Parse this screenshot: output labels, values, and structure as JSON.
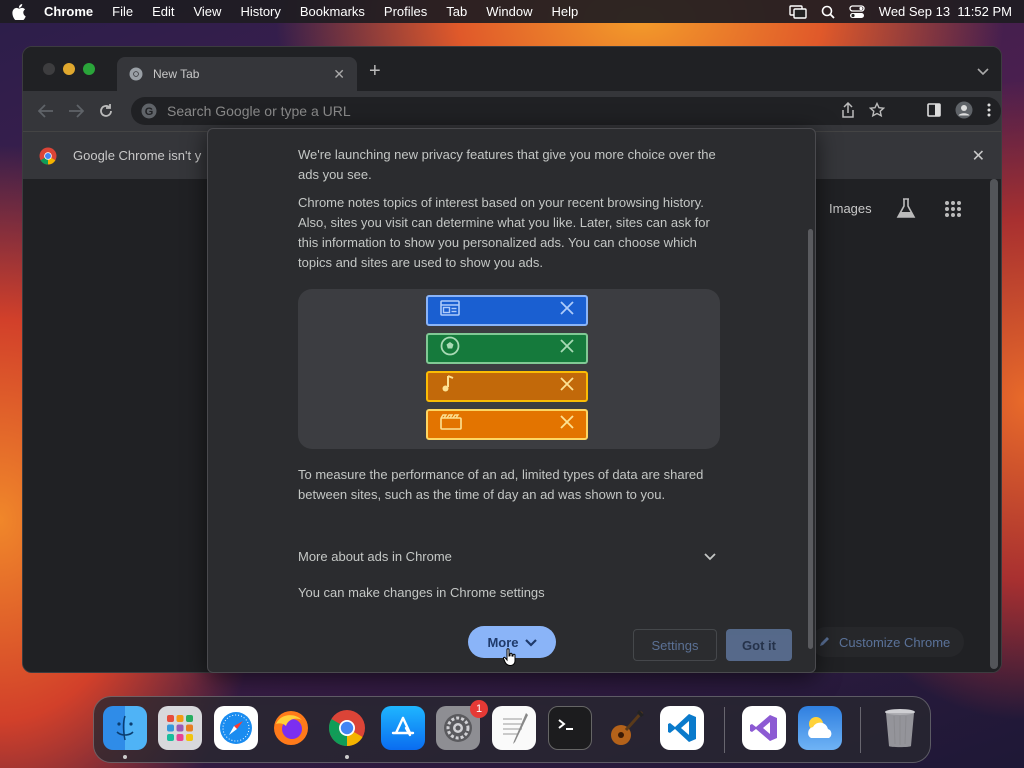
{
  "menubar": {
    "app_name": "Chrome",
    "menus": [
      "File",
      "Edit",
      "View",
      "History",
      "Bookmarks",
      "Profiles",
      "Tab",
      "Window",
      "Help"
    ],
    "clock": "Wed Sep 13  11:52 PM"
  },
  "browser": {
    "tab_title": "New Tab",
    "omnibox_placeholder": "Search Google or type a URL",
    "infobar_text": "Google Chrome isn't y",
    "images_link": "Images",
    "customize_button": "Customize Chrome"
  },
  "dialog": {
    "intro": "We're launching new privacy features that give you more choice over the ads you see.",
    "topics": "Chrome notes topics of interest based on your recent browsing history. Also, sites you visit can determine what you like. Later, sites can ask for this information to show you personalized ads. You can choose which topics and sites are used to show you ads.",
    "illustration_rows": [
      {
        "icon": "browser-window-icon",
        "color": "#1a5fd1",
        "border": "#8ab4f8",
        "fg": "#aecbfa"
      },
      {
        "icon": "soccer-ball-icon",
        "color": "#157a3c",
        "border": "#81c995",
        "fg": "#a8dab5"
      },
      {
        "icon": "music-note-icon",
        "color": "#c2690a",
        "border": "#fbbc04",
        "fg": "#fde293"
      },
      {
        "icon": "clapperboard-icon",
        "color": "#e37400",
        "border": "#fdd663",
        "fg": "#fde293"
      }
    ],
    "measure": "To measure the performance of an ad, limited types of data are shared between sites, such as the time of day an ad was shown to you.",
    "more_about": "More about ads in Chrome",
    "settings_note": "You can make changes in Chrome settings",
    "more_button": "More",
    "settings_button": "Settings",
    "gotit_button": "Got it"
  },
  "dock": {
    "apps": [
      "Finder",
      "Launchpad",
      "Safari",
      "Firefox",
      "Chrome",
      "App Store",
      "System Settings",
      "TextEdit",
      "Terminal",
      "GarageBand",
      "Visual Studio Code",
      "Visual Studio",
      "Weather",
      "Trash"
    ],
    "settings_badge": "1"
  }
}
